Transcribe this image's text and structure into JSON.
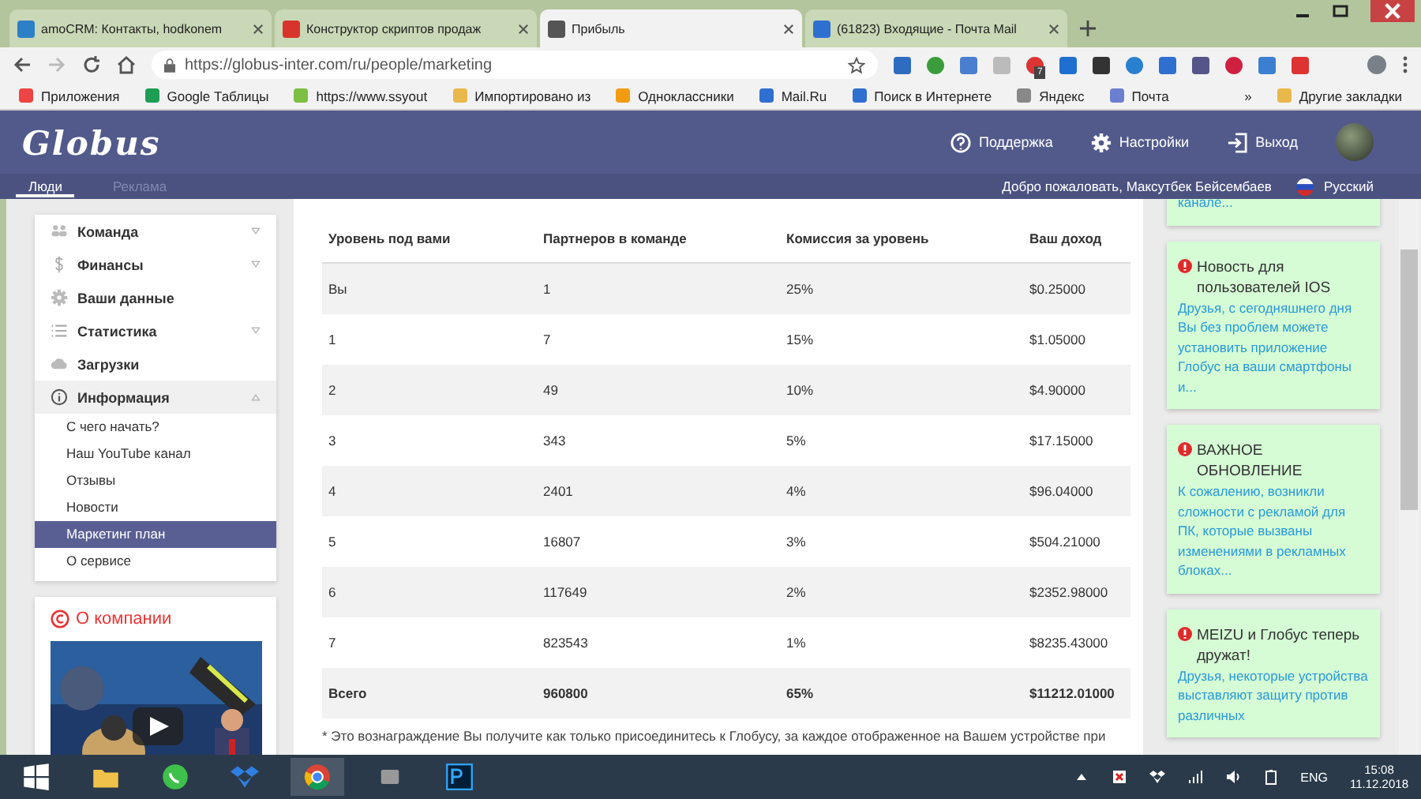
{
  "browser": {
    "tabs": [
      {
        "title": "amoCRM: Контакты, hodkonem",
        "selected": false
      },
      {
        "title": "Конструктор скриптов продаж",
        "selected": false
      },
      {
        "title": "Прибыль",
        "selected": true
      },
      {
        "title": "(61823) Входящие - Почта Mail",
        "selected": false
      }
    ],
    "url": "https://globus-inter.com/ru/people/marketing",
    "bookmarks": [
      "Приложения",
      "Google Таблицы",
      "https://www.ssyout",
      "Импортировано из",
      "Одноклассники",
      "Mail.Ru",
      "Поиск в Интернете",
      "Яндекс",
      "Почта"
    ],
    "more_bookmarks": "»",
    "other_bookmarks": "Другие закладки",
    "badge": "7"
  },
  "header": {
    "logo": "Globus",
    "links": [
      "Поддержка",
      "Настройки",
      "Выход"
    ],
    "tabs": [
      {
        "label": "Люди",
        "selected": true
      },
      {
        "label": "Реклама",
        "selected": false
      }
    ],
    "welcome": "Добро пожаловать, Максутбек Бейсембаев",
    "language": "Русский"
  },
  "menu": [
    {
      "label": "Команда",
      "kind": "group",
      "expanded": false
    },
    {
      "label": "Финансы",
      "kind": "group",
      "expanded": false
    },
    {
      "label": "Ваши данные",
      "kind": "link"
    },
    {
      "label": "Статистика",
      "kind": "group",
      "expanded": false
    },
    {
      "label": "Загрузки",
      "kind": "link"
    },
    {
      "label": "Информация",
      "kind": "group",
      "expanded": true,
      "children": [
        {
          "label": "С чего начать?",
          "selected": false
        },
        {
          "label": "Наш YouTube канал",
          "selected": false
        },
        {
          "label": "Отзывы",
          "selected": false
        },
        {
          "label": "Новости",
          "selected": false
        },
        {
          "label": "Маркетинг план",
          "selected": true
        },
        {
          "label": "О сервисе",
          "selected": false
        }
      ]
    }
  ],
  "about": {
    "title": "О компании"
  },
  "table": {
    "columns": [
      "Уровень под вами",
      "Партнеров в команде",
      "Комиссия за уровень",
      "Ваш доход"
    ],
    "rows": [
      {
        "kind": "row",
        "cells": [
          "Вы",
          "1",
          "25%",
          "$0.25000"
        ]
      },
      {
        "kind": "row",
        "cells": [
          "1",
          "7",
          "15%",
          "$1.05000"
        ]
      },
      {
        "kind": "row",
        "cells": [
          "2",
          "49",
          "10%",
          "$4.90000"
        ]
      },
      {
        "kind": "row",
        "cells": [
          "3",
          "343",
          "5%",
          "$17.15000"
        ]
      },
      {
        "kind": "row",
        "cells": [
          "4",
          "2401",
          "4%",
          "$96.04000"
        ]
      },
      {
        "kind": "row",
        "cells": [
          "5",
          "16807",
          "3%",
          "$504.21000"
        ]
      },
      {
        "kind": "row",
        "cells": [
          "6",
          "117649",
          "2%",
          "$2352.98000"
        ]
      },
      {
        "kind": "row",
        "cells": [
          "7",
          "823543",
          "1%",
          "$8235.43000"
        ]
      },
      {
        "kind": "total",
        "cells": [
          "Всего",
          "960800",
          "65%",
          "$11212.01000"
        ]
      }
    ]
  },
  "footnote": "* Это вознаграждение Вы получите как только присоединитесь к Глобусу, за каждое отображенное на Вашем устройстве при",
  "news": [
    {
      "text": "канале..."
    },
    {
      "title": "Новость для пользователей IOS",
      "text": "Друзья, с сегодняшнего дня Вы без проблем можете установить приложение Глобус на ваши смартфоны и..."
    },
    {
      "title": "ВАЖНОЕ ОБНОВЛЕНИЕ",
      "text": "К сожалению, возникли сложности с рекламой для ПК, которые вызваны изменениями в рекламных блоках..."
    },
    {
      "title": "MEIZU и Глобус теперь дружат!",
      "text": "Друзья, некоторые устройства выставляют защиту против различных"
    }
  ],
  "taskbar": {
    "language": "ENG",
    "time": "15:08",
    "date": "11.12.2018"
  }
}
